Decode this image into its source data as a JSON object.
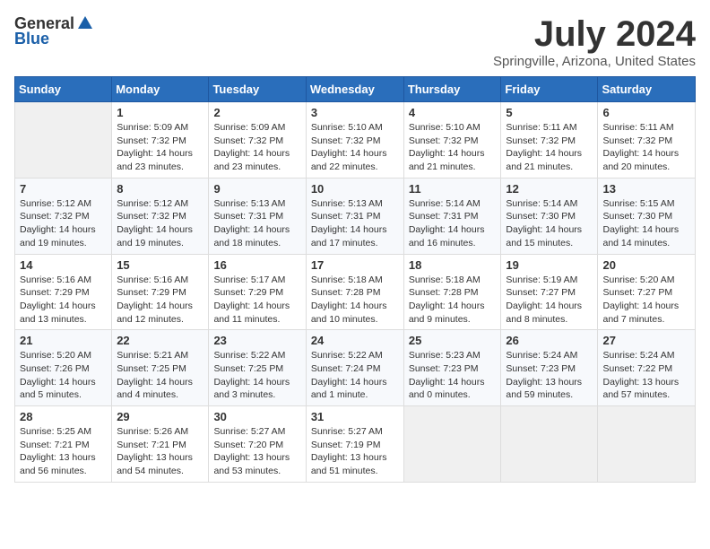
{
  "logo": {
    "general": "General",
    "blue": "Blue"
  },
  "title": "July 2024",
  "location": "Springville, Arizona, United States",
  "days_header": [
    "Sunday",
    "Monday",
    "Tuesday",
    "Wednesday",
    "Thursday",
    "Friday",
    "Saturday"
  ],
  "weeks": [
    [
      {
        "day": "",
        "info": ""
      },
      {
        "day": "1",
        "info": "Sunrise: 5:09 AM\nSunset: 7:32 PM\nDaylight: 14 hours\nand 23 minutes."
      },
      {
        "day": "2",
        "info": "Sunrise: 5:09 AM\nSunset: 7:32 PM\nDaylight: 14 hours\nand 23 minutes."
      },
      {
        "day": "3",
        "info": "Sunrise: 5:10 AM\nSunset: 7:32 PM\nDaylight: 14 hours\nand 22 minutes."
      },
      {
        "day": "4",
        "info": "Sunrise: 5:10 AM\nSunset: 7:32 PM\nDaylight: 14 hours\nand 21 minutes."
      },
      {
        "day": "5",
        "info": "Sunrise: 5:11 AM\nSunset: 7:32 PM\nDaylight: 14 hours\nand 21 minutes."
      },
      {
        "day": "6",
        "info": "Sunrise: 5:11 AM\nSunset: 7:32 PM\nDaylight: 14 hours\nand 20 minutes."
      }
    ],
    [
      {
        "day": "7",
        "info": "Sunrise: 5:12 AM\nSunset: 7:32 PM\nDaylight: 14 hours\nand 19 minutes."
      },
      {
        "day": "8",
        "info": "Sunrise: 5:12 AM\nSunset: 7:32 PM\nDaylight: 14 hours\nand 19 minutes."
      },
      {
        "day": "9",
        "info": "Sunrise: 5:13 AM\nSunset: 7:31 PM\nDaylight: 14 hours\nand 18 minutes."
      },
      {
        "day": "10",
        "info": "Sunrise: 5:13 AM\nSunset: 7:31 PM\nDaylight: 14 hours\nand 17 minutes."
      },
      {
        "day": "11",
        "info": "Sunrise: 5:14 AM\nSunset: 7:31 PM\nDaylight: 14 hours\nand 16 minutes."
      },
      {
        "day": "12",
        "info": "Sunrise: 5:14 AM\nSunset: 7:30 PM\nDaylight: 14 hours\nand 15 minutes."
      },
      {
        "day": "13",
        "info": "Sunrise: 5:15 AM\nSunset: 7:30 PM\nDaylight: 14 hours\nand 14 minutes."
      }
    ],
    [
      {
        "day": "14",
        "info": "Sunrise: 5:16 AM\nSunset: 7:29 PM\nDaylight: 14 hours\nand 13 minutes."
      },
      {
        "day": "15",
        "info": "Sunrise: 5:16 AM\nSunset: 7:29 PM\nDaylight: 14 hours\nand 12 minutes."
      },
      {
        "day": "16",
        "info": "Sunrise: 5:17 AM\nSunset: 7:29 PM\nDaylight: 14 hours\nand 11 minutes."
      },
      {
        "day": "17",
        "info": "Sunrise: 5:18 AM\nSunset: 7:28 PM\nDaylight: 14 hours\nand 10 minutes."
      },
      {
        "day": "18",
        "info": "Sunrise: 5:18 AM\nSunset: 7:28 PM\nDaylight: 14 hours\nand 9 minutes."
      },
      {
        "day": "19",
        "info": "Sunrise: 5:19 AM\nSunset: 7:27 PM\nDaylight: 14 hours\nand 8 minutes."
      },
      {
        "day": "20",
        "info": "Sunrise: 5:20 AM\nSunset: 7:27 PM\nDaylight: 14 hours\nand 7 minutes."
      }
    ],
    [
      {
        "day": "21",
        "info": "Sunrise: 5:20 AM\nSunset: 7:26 PM\nDaylight: 14 hours\nand 5 minutes."
      },
      {
        "day": "22",
        "info": "Sunrise: 5:21 AM\nSunset: 7:25 PM\nDaylight: 14 hours\nand 4 minutes."
      },
      {
        "day": "23",
        "info": "Sunrise: 5:22 AM\nSunset: 7:25 PM\nDaylight: 14 hours\nand 3 minutes."
      },
      {
        "day": "24",
        "info": "Sunrise: 5:22 AM\nSunset: 7:24 PM\nDaylight: 14 hours\nand 1 minute."
      },
      {
        "day": "25",
        "info": "Sunrise: 5:23 AM\nSunset: 7:23 PM\nDaylight: 14 hours\nand 0 minutes."
      },
      {
        "day": "26",
        "info": "Sunrise: 5:24 AM\nSunset: 7:23 PM\nDaylight: 13 hours\nand 59 minutes."
      },
      {
        "day": "27",
        "info": "Sunrise: 5:24 AM\nSunset: 7:22 PM\nDaylight: 13 hours\nand 57 minutes."
      }
    ],
    [
      {
        "day": "28",
        "info": "Sunrise: 5:25 AM\nSunset: 7:21 PM\nDaylight: 13 hours\nand 56 minutes."
      },
      {
        "day": "29",
        "info": "Sunrise: 5:26 AM\nSunset: 7:21 PM\nDaylight: 13 hours\nand 54 minutes."
      },
      {
        "day": "30",
        "info": "Sunrise: 5:27 AM\nSunset: 7:20 PM\nDaylight: 13 hours\nand 53 minutes."
      },
      {
        "day": "31",
        "info": "Sunrise: 5:27 AM\nSunset: 7:19 PM\nDaylight: 13 hours\nand 51 minutes."
      },
      {
        "day": "",
        "info": ""
      },
      {
        "day": "",
        "info": ""
      },
      {
        "day": "",
        "info": ""
      }
    ]
  ]
}
